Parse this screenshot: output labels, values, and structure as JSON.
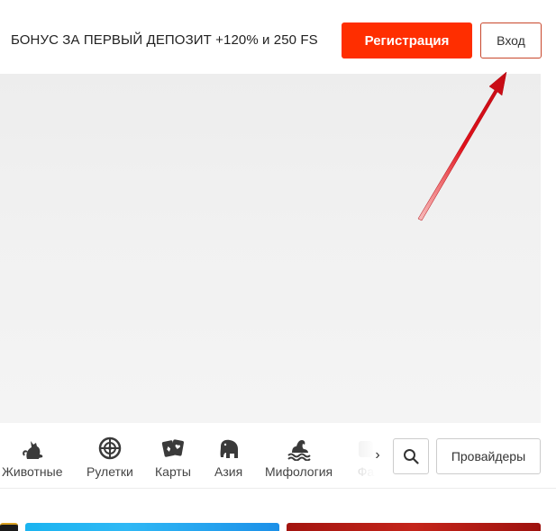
{
  "header": {
    "promo_text": "БОНУС ЗА ПЕРВЫЙ ДЕПОЗИТ +120% и 250 FS",
    "register_label": "Регистрация",
    "login_label": "Вход"
  },
  "categories": {
    "items": [
      {
        "label": "Животные",
        "icon": "cat-icon"
      },
      {
        "label": "Рулетки",
        "icon": "roulette-icon"
      },
      {
        "label": "Карты",
        "icon": "cards-icon"
      },
      {
        "label": "Азия",
        "icon": "elephant-icon"
      },
      {
        "label": "Мифология",
        "icon": "sea-monster-icon"
      },
      {
        "label": "Фа",
        "icon": "partial-icon"
      }
    ],
    "next_glyph": "›",
    "providers_label": "Провайдеры"
  },
  "colors": {
    "accent": "#ff2e00",
    "login_border": "#c8472c",
    "arrow": "#e0101a"
  }
}
